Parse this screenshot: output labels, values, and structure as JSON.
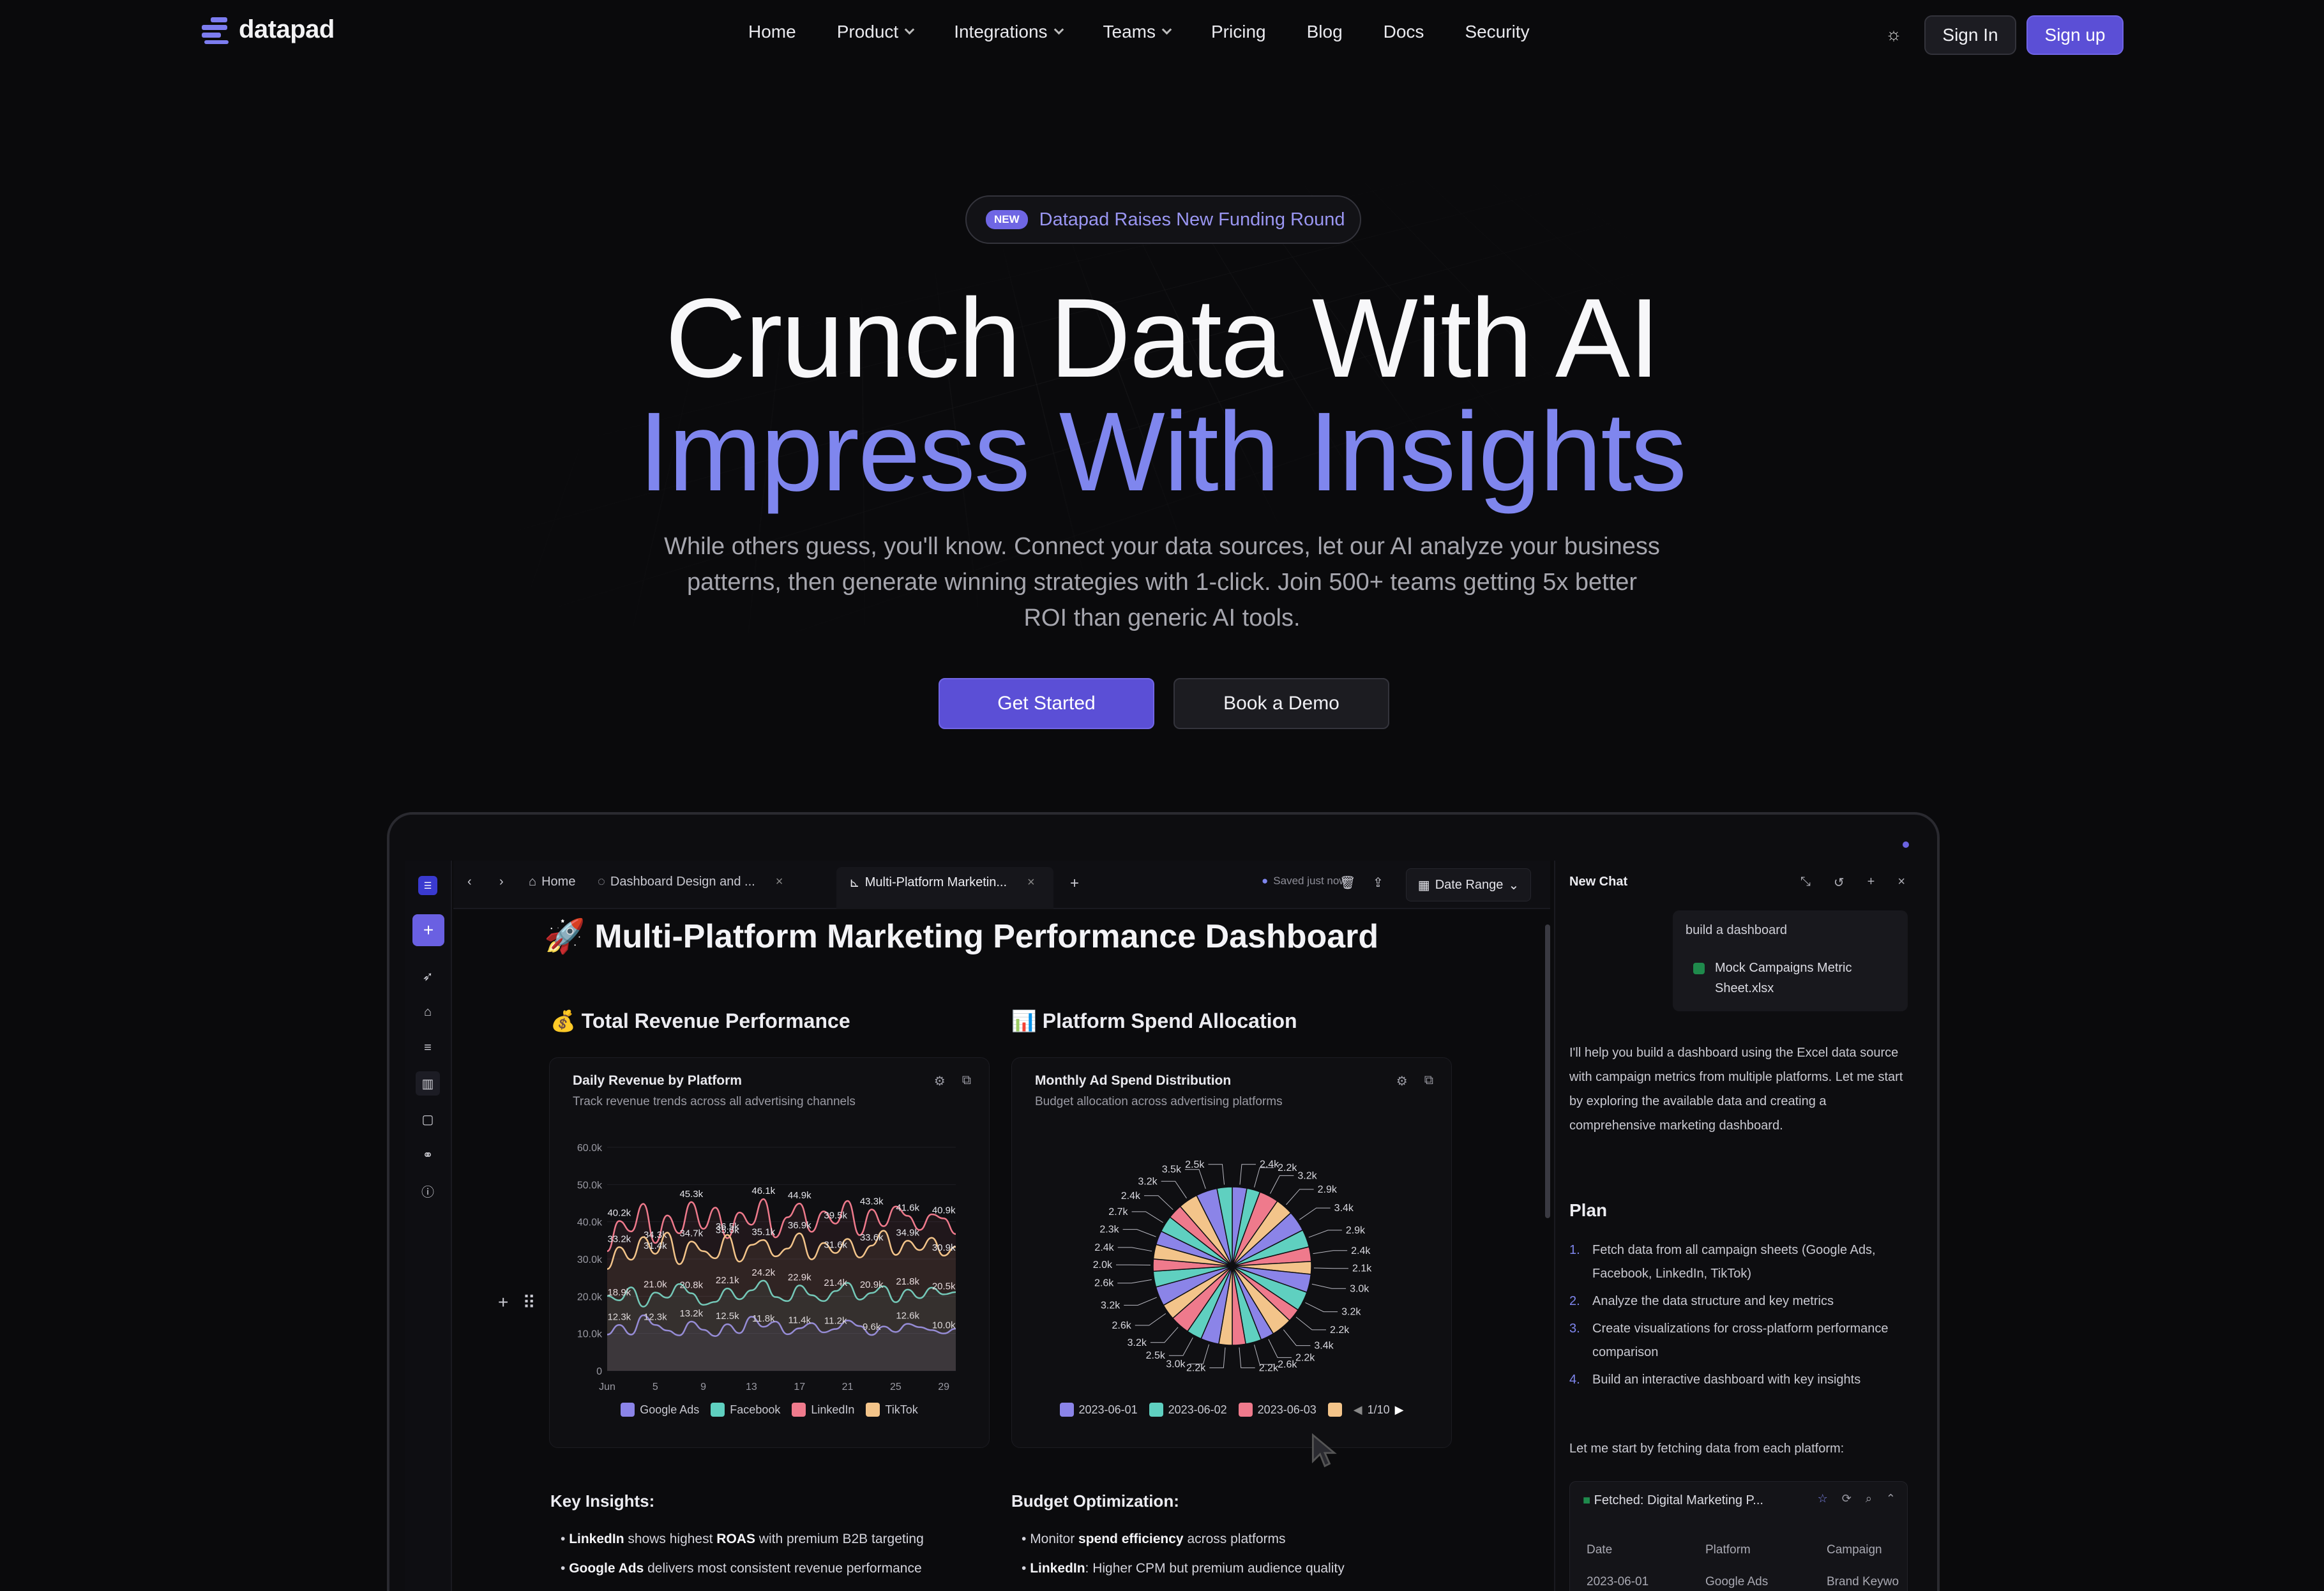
{
  "brand": {
    "name": "datapad",
    "accent": "#5b4fd6",
    "accent_light": "#7f86ee"
  },
  "nav": {
    "items": [
      {
        "label": "Home",
        "dropdown": false
      },
      {
        "label": "Product",
        "dropdown": true
      },
      {
        "label": "Integrations",
        "dropdown": true
      },
      {
        "label": "Teams",
        "dropdown": true
      },
      {
        "label": "Pricing",
        "dropdown": false
      },
      {
        "label": "Blog",
        "dropdown": false
      },
      {
        "label": "Docs",
        "dropdown": false
      },
      {
        "label": "Security",
        "dropdown": false
      }
    ],
    "theme_icon": "sun-icon",
    "sign_in": "Sign In",
    "sign_up": "Sign up"
  },
  "hero": {
    "badge_tag": "NEW",
    "badge_text": "Datapad Raises New Funding Round",
    "headline_1": "Crunch Data With AI",
    "headline_2": "Impress With Insights",
    "subtitle": "While others guess, you'll know. Connect your data sources, let our AI analyze your business patterns, then generate winning strategies with 1-click. Join 500+ teams getting 5x better ROI than generic AI tools.",
    "cta_primary": "Get Started",
    "cta_secondary": "Book a Demo"
  },
  "app": {
    "tabs": {
      "home": "Home",
      "tab1": "Dashboard Design and ...",
      "tab2": "Multi-Platform Marketin...",
      "saved": "Saved just now",
      "date_range": "Date Range"
    },
    "dashboard_title": "🚀 Multi-Platform Marketing Performance Dashboard",
    "revenue_section": "💰 Total Revenue Performance",
    "spend_section": "📊 Platform Spend Allocation",
    "revenue_card": {
      "title": "Daily Revenue by Platform",
      "subtitle": "Track revenue trends across all advertising channels"
    },
    "spend_card": {
      "title": "Monthly Ad Spend Distribution",
      "subtitle": "Budget allocation across advertising platforms",
      "legend": [
        "2023-06-01",
        "2023-06-02",
        "2023-06-03"
      ],
      "pager": "1/10"
    },
    "key_insights": {
      "heading": "Key Insights:",
      "items": [
        {
          "bold": "LinkedIn",
          "mid": " shows highest ",
          "bold2": "ROAS",
          "rest": " with premium B2B targeting"
        },
        {
          "bold": "Google Ads",
          "mid": " delivers most consistent revenue performance",
          "bold2": "",
          "rest": ""
        }
      ]
    },
    "budget_opt": {
      "heading": "Budget Optimization:",
      "items": [
        {
          "pre": "Monitor ",
          "bold": "spend efficiency",
          "rest": " across platforms"
        },
        {
          "pre": "",
          "bold": "LinkedIn",
          "rest": ": Higher CPM but premium audience quality"
        }
      ]
    }
  },
  "chat": {
    "title": "New Chat",
    "user_msg": "build a dashboard",
    "attachment": "Mock Campaigns Metric Sheet.xlsx",
    "assistant_msg": "I'll help you build a dashboard using the Excel data source with campaign metrics from multiple platforms. Let me start by exploring the available data and creating a comprehensive marketing dashboard.",
    "plan_heading": "Plan",
    "plan": [
      "Fetch data from all campaign sheets (Google Ads, Facebook, LinkedIn, TikTok)",
      "Analyze the data structure and key metrics",
      "Create visualizations for cross-platform performance comparison",
      "Build an interactive dashboard with key insights"
    ],
    "followup": "Let me start by fetching data from each platform:",
    "fetched_title": "Fetched: Digital Marketing P...",
    "fetched_columns": [
      "Date",
      "Platform",
      "Campaign"
    ],
    "fetched_rows": [
      [
        "2023-06-01",
        "Google Ads",
        "Brand Keywo"
      ]
    ]
  },
  "chart_data": [
    {
      "type": "line",
      "title": "Daily Revenue by Platform",
      "ylim": [
        0,
        60000
      ],
      "yticks": [
        "0",
        "10.0k",
        "20.0k",
        "30.0k",
        "40.0k",
        "50.0k",
        "60.0k"
      ],
      "xticks": [
        "Jun",
        "5",
        "9",
        "13",
        "17",
        "21",
        "25",
        "29"
      ],
      "x": [
        1,
        2,
        3,
        4,
        5,
        6,
        7,
        8,
        9,
        10,
        11,
        12,
        13,
        14,
        15,
        16,
        17,
        18,
        19,
        20,
        21,
        22,
        23,
        24,
        25,
        26,
        27,
        28,
        29,
        30
      ],
      "series": [
        {
          "name": "Google Ads",
          "color": "#8b84e8",
          "values": [
            9700,
            12300,
            9700,
            14900,
            12300,
            10800,
            9500,
            13200,
            11000,
            9300,
            12500,
            10100,
            14500,
            11800,
            13200,
            9800,
            11400,
            12800,
            10300,
            11200,
            13500,
            12000,
            9600,
            11900,
            10400,
            12600,
            11700,
            10900,
            10000,
            11300
          ]
        },
        {
          "name": "Facebook",
          "color": "#5fd0c0",
          "values": [
            20100,
            18900,
            22400,
            17200,
            21000,
            19600,
            23300,
            20800,
            17700,
            18500,
            22100,
            19200,
            21600,
            24200,
            19800,
            18700,
            22900,
            20300,
            18700,
            21400,
            23600,
            19100,
            20900,
            22700,
            18400,
            21800,
            19500,
            22300,
            20500,
            21100
          ]
        },
        {
          "name": "LinkedIn",
          "color": "#ef7a8c",
          "values": [
            32100,
            40200,
            37400,
            44800,
            34300,
            41700,
            36900,
            45300,
            38100,
            43800,
            35600,
            42500,
            39200,
            46100,
            35800,
            41200,
            44900,
            37300,
            42800,
            39500,
            45600,
            36400,
            43300,
            38800,
            44100,
            41600,
            37800,
            42000,
            40900,
            36700
          ]
        },
        {
          "name": "TikTok",
          "color": "#f3c48a",
          "values": [
            27300,
            33200,
            29800,
            35900,
            31400,
            37100,
            28600,
            34700,
            32100,
            30200,
            36500,
            29300,
            33800,
            35100,
            30700,
            32800,
            36900,
            29900,
            34300,
            31600,
            35400,
            30400,
            33600,
            37600,
            31100,
            34900,
            32400,
            35700,
            30900,
            33300
          ]
        }
      ]
    },
    {
      "type": "pie",
      "title": "Monthly Ad Spend Distribution",
      "colors": [
        "#8b84e8",
        "#5fd0c0",
        "#ef7a8c",
        "#f3c48a"
      ],
      "slice_labels": [
        "2.4k",
        "2.2k",
        "3.2k",
        "2.9k",
        "3.4k",
        "2.9k",
        "2.4k",
        "2.1k",
        "3.0k",
        "3.2k",
        "2.2k",
        "3.4k",
        "2.2k",
        "2.6k",
        "2.2k",
        "2.2k",
        "3.0k",
        "2.5k",
        "3.2k",
        "2.6k",
        "3.2k",
        "2.6k",
        "2.0k",
        "2.4k",
        "2.3k",
        "2.7k",
        "2.4k",
        "3.2k",
        "3.5k",
        "2.5k"
      ],
      "values": [
        2400,
        2200,
        3200,
        2900,
        3400,
        2900,
        2400,
        2100,
        3000,
        3200,
        2200,
        3400,
        2200,
        2600,
        2200,
        2200,
        3000,
        2500,
        3200,
        2600,
        3200,
        2600,
        2000,
        2400,
        2300,
        2700,
        2400,
        3200,
        3500,
        2500
      ]
    }
  ]
}
